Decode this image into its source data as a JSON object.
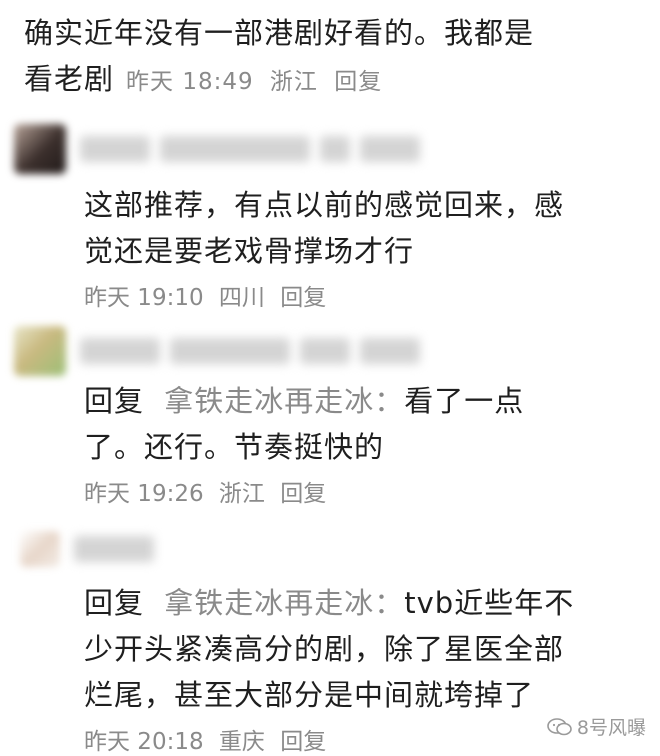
{
  "top_comment": {
    "text_line1": "确实近年没有一部港剧好看的。我都是",
    "text_line2": "看老剧",
    "date": "昨天 18:49",
    "location": "浙江",
    "reply": "回复"
  },
  "replies": [
    {
      "avatar_icon": "blurred-avatar",
      "line1": "这部推荐，有点以前的感觉回来，感",
      "line2": "觉还是要老戏骨撑场才行",
      "date": "昨天 19:10",
      "location": "四川",
      "reply": "回复"
    },
    {
      "avatar_icon": "blurred-avatar",
      "reply_label": "回复",
      "reply_to": "拿铁走冰再走冰：",
      "line1_rest": "看了一点",
      "line2": "了。还行。节奏挺快的",
      "date": "昨天 19:26",
      "location": "浙江",
      "reply": "回复"
    },
    {
      "avatar_icon": "blurred-avatar",
      "reply_label": "回复",
      "reply_to": "拿铁走冰再走冰：",
      "line1_rest": "tvb近些年不",
      "line2": "少开头紧凑高分的剧，除了星医全部",
      "line3": "烂尾，甚至大部分是中间就垮掉了",
      "date": "昨天 20:18",
      "location": "重庆",
      "reply": "回复"
    }
  ],
  "watermark": {
    "text": "8号风曝",
    "icon": "wechat-icon"
  }
}
